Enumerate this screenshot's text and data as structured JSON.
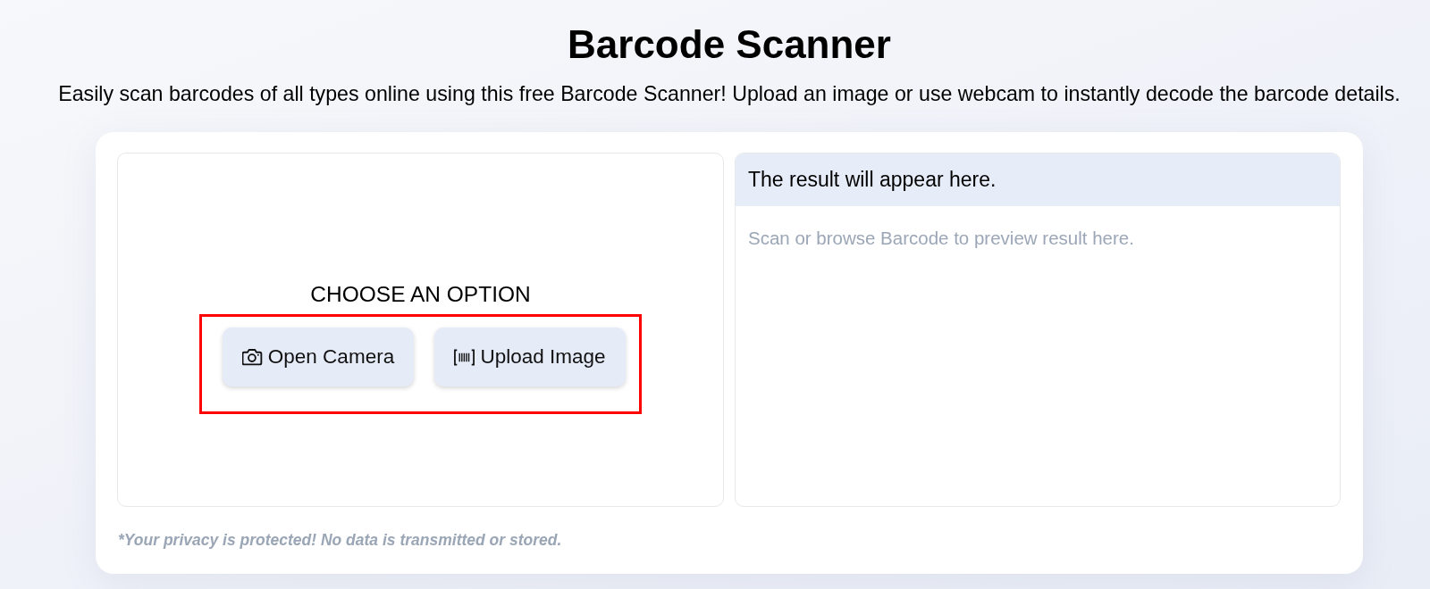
{
  "header": {
    "title": "Barcode Scanner",
    "subtitle": "Easily scan barcodes of all types online using this free Barcode Scanner! Upload an image or use webcam to instantly decode the barcode details."
  },
  "scanner": {
    "heading": "CHOOSE AN OPTION",
    "buttons": [
      {
        "kind": "camera",
        "label": "Open Camera"
      },
      {
        "kind": "barcode",
        "label": "Upload Image"
      }
    ]
  },
  "result": {
    "title": "The result will appear here.",
    "message": "Scan or browse Barcode to preview result here."
  },
  "privacy_note": "*Your privacy is protected! No data is transmitted or stored."
}
